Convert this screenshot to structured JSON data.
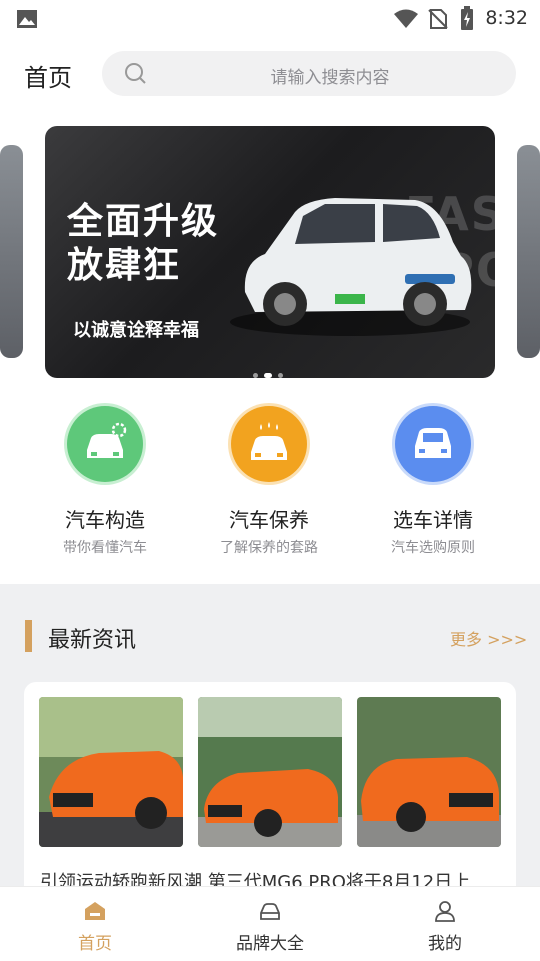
{
  "status_bar": {
    "time": "8:32"
  },
  "header": {
    "title": "首页",
    "search_placeholder": "请输入搜索内容"
  },
  "banner": {
    "headline_line1": "全面升级",
    "headline_line2": "放肆狂",
    "subtitle": "以诚意诠释幸福",
    "background_word": "FASHION SPORT",
    "active_dot": 1,
    "dot_count": 3
  },
  "features": [
    {
      "title": "汽车构造",
      "desc": "带你看懂汽车",
      "color": "#5ec87a",
      "icon": "car-gear-icon"
    },
    {
      "title": "汽车保养",
      "desc": "了解保养的套路",
      "color": "#f2a31f",
      "icon": "car-wash-icon"
    },
    {
      "title": "选车详情",
      "desc": "汽车选购原则",
      "color": "#5b8def",
      "icon": "car-front-icon"
    }
  ],
  "news": {
    "section_title": "最新资讯",
    "more_label": "更多 >>>",
    "article_title": "引领运动轿跑新风潮 第三代MG6 PRO将于8月12日上"
  },
  "tab_bar": {
    "tabs": [
      {
        "label": "首页",
        "active": true,
        "icon": "home-icon"
      },
      {
        "label": "品牌大全",
        "active": false,
        "icon": "car-icon"
      },
      {
        "label": "我的",
        "active": false,
        "icon": "user-icon"
      }
    ]
  },
  "colors": {
    "accent": "#d4a15f",
    "background_section": "#eff0f2"
  }
}
